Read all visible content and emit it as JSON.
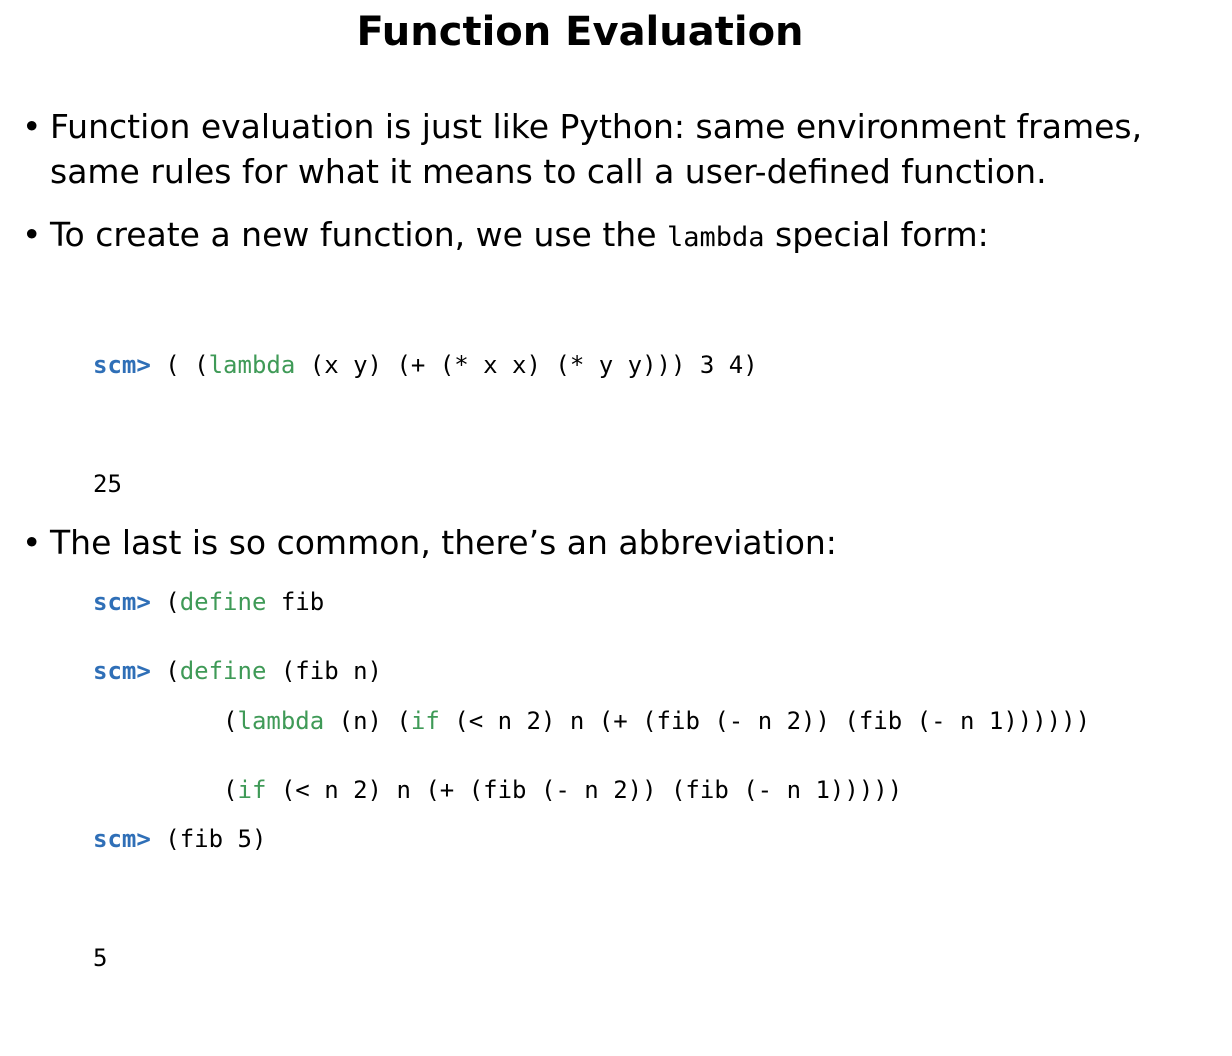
{
  "slide": {
    "title": "Function Evaluation"
  },
  "bullets": [
    {
      "marker": "•",
      "lines": [
        "Function evaluation is just like Python:  same environment frames,",
        "same rules for what it means to call a user-defined function."
      ]
    },
    {
      "marker": "•",
      "before": "To create a new function, we use the ",
      "code": "lambda",
      "after": " special form:"
    },
    {
      "marker": "•",
      "text": "The last is so common, there’s an abbreviation:"
    }
  ],
  "code_blocks": {
    "lambda_examples": [
      {
        "prompt": "scm>",
        "t1": " ( (",
        "kw1": "lambda",
        "t2": " (x y) (+ (* x x) (* y y))) 3 4)"
      },
      {
        "output": "25"
      },
      {
        "prompt": "scm>",
        "t1": " (",
        "kw1": "define",
        "t2": " fib"
      },
      {
        "indent": "         (",
        "kw1": "lambda",
        "t2": " (n) (",
        "kw2": "if",
        "t3": " (< n 2) n (+ (fib (- n 2)) (fib (- n 1))))))"
      },
      {
        "prompt": "scm>",
        "t1": " (fib 5)"
      },
      {
        "output": "5"
      }
    ],
    "define_abbrev": [
      {
        "prompt": "scm>",
        "t1": " (",
        "kw1": "define",
        "t2": " (fib n)"
      },
      {
        "indent": "         (",
        "kw1": "if",
        "t2": " (< n 2) n (+ (fib (- n 2)) (fib (- n 1)))))"
      }
    ]
  },
  "colors": {
    "prompt": "#2f6fb7",
    "keyword": "#3f9a57",
    "text": "#000000",
    "background": "#ffffff"
  }
}
